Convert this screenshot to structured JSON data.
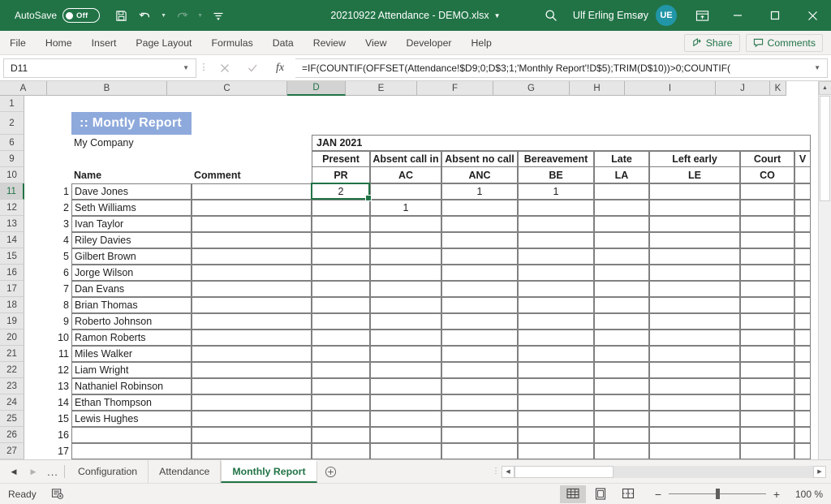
{
  "titlebar": {
    "autosave_label": "AutoSave",
    "autosave_state": "Off",
    "document_title": "20210922 Attendance - DEMO.xlsx",
    "user_name": "Ulf Erling Emsøy",
    "avatar_initials": "UE",
    "qat": [
      "save-icon",
      "undo-icon",
      "redo-icon",
      "customize-qat-icon"
    ],
    "window_buttons": [
      "minimize",
      "maximize",
      "close"
    ],
    "search_icon": "search-icon",
    "ribbon_display_icon": "ribbon-display-options-icon"
  },
  "ribbon": {
    "tabs": [
      "File",
      "Home",
      "Insert",
      "Page Layout",
      "Formulas",
      "Data",
      "Review",
      "View",
      "Developer",
      "Help"
    ],
    "share_label": "Share",
    "comments_label": "Comments"
  },
  "formulabar": {
    "namebox_value": "D11",
    "cancel_icon": "cancel-icon",
    "enter_icon": "confirm-icon",
    "function_icon": "insert-function-icon",
    "formula": "=IF(COUNTIF(OFFSET(Attendance!$D9;0;D$3;1;'Monthly Report'!D$5);TRIM(D$10))>0;COUNTIF("
  },
  "grid": {
    "columns": [
      "A",
      "B",
      "C",
      "D",
      "E",
      "F",
      "G",
      "H",
      "I",
      "J",
      "K"
    ],
    "selected_column": "D",
    "selected_row": "11",
    "row_headers": [
      "1",
      "2",
      "6",
      "9",
      "10",
      "11",
      "12",
      "13",
      "14",
      "15",
      "16",
      "17",
      "18",
      "19",
      "20",
      "21",
      "22",
      "23",
      "24",
      "25",
      "26",
      "27"
    ],
    "report_title": ":: Montly Report",
    "company": "My Company",
    "period": "JAN 2021",
    "header_name": "Name",
    "header_comment": "Comment",
    "category_headers": [
      "Present",
      "Absent call in",
      "Absent no call",
      "Bereavement",
      "Late",
      "Left early",
      "Court",
      "V"
    ],
    "category_codes": [
      "PR",
      "AC",
      "ANC",
      "BE",
      "LA",
      "LE",
      "CO",
      ""
    ],
    "rows": [
      {
        "num": "1",
        "name": "Dave Jones",
        "comment": "",
        "pr": "2",
        "ac": "",
        "anc": "1",
        "be": "1",
        "la": "",
        "le": "",
        "co": "",
        "v": ""
      },
      {
        "num": "2",
        "name": "Seth Williams",
        "comment": "",
        "pr": "",
        "ac": "1",
        "anc": "",
        "be": "",
        "la": "",
        "le": "",
        "co": "",
        "v": ""
      },
      {
        "num": "3",
        "name": "Ivan Taylor",
        "comment": "",
        "pr": "",
        "ac": "",
        "anc": "",
        "be": "",
        "la": "",
        "le": "",
        "co": "",
        "v": ""
      },
      {
        "num": "4",
        "name": "Riley Davies",
        "comment": "",
        "pr": "",
        "ac": "",
        "anc": "",
        "be": "",
        "la": "",
        "le": "",
        "co": "",
        "v": ""
      },
      {
        "num": "5",
        "name": "Gilbert Brown",
        "comment": "",
        "pr": "",
        "ac": "",
        "anc": "",
        "be": "",
        "la": "",
        "le": "",
        "co": "",
        "v": ""
      },
      {
        "num": "6",
        "name": "Jorge Wilson",
        "comment": "",
        "pr": "",
        "ac": "",
        "anc": "",
        "be": "",
        "la": "",
        "le": "",
        "co": "",
        "v": ""
      },
      {
        "num": "7",
        "name": "Dan Evans",
        "comment": "",
        "pr": "",
        "ac": "",
        "anc": "",
        "be": "",
        "la": "",
        "le": "",
        "co": "",
        "v": ""
      },
      {
        "num": "8",
        "name": "Brian Thomas",
        "comment": "",
        "pr": "",
        "ac": "",
        "anc": "",
        "be": "",
        "la": "",
        "le": "",
        "co": "",
        "v": ""
      },
      {
        "num": "9",
        "name": "Roberto Johnson",
        "comment": "",
        "pr": "",
        "ac": "",
        "anc": "",
        "be": "",
        "la": "",
        "le": "",
        "co": "",
        "v": ""
      },
      {
        "num": "10",
        "name": "Ramon Roberts",
        "comment": "",
        "pr": "",
        "ac": "",
        "anc": "",
        "be": "",
        "la": "",
        "le": "",
        "co": "",
        "v": ""
      },
      {
        "num": "11",
        "name": "Miles Walker",
        "comment": "",
        "pr": "",
        "ac": "",
        "anc": "",
        "be": "",
        "la": "",
        "le": "",
        "co": "",
        "v": ""
      },
      {
        "num": "12",
        "name": "Liam Wright",
        "comment": "",
        "pr": "",
        "ac": "",
        "anc": "",
        "be": "",
        "la": "",
        "le": "",
        "co": "",
        "v": ""
      },
      {
        "num": "13",
        "name": "Nathaniel Robinson",
        "comment": "",
        "pr": "",
        "ac": "",
        "anc": "",
        "be": "",
        "la": "",
        "le": "",
        "co": "",
        "v": ""
      },
      {
        "num": "14",
        "name": "Ethan Thompson",
        "comment": "",
        "pr": "",
        "ac": "",
        "anc": "",
        "be": "",
        "la": "",
        "le": "",
        "co": "",
        "v": ""
      },
      {
        "num": "15",
        "name": "Lewis Hughes",
        "comment": "",
        "pr": "",
        "ac": "",
        "anc": "",
        "be": "",
        "la": "",
        "le": "",
        "co": "",
        "v": ""
      },
      {
        "num": "16",
        "name": "",
        "comment": "",
        "pr": "",
        "ac": "",
        "anc": "",
        "be": "",
        "la": "",
        "le": "",
        "co": "",
        "v": ""
      },
      {
        "num": "17",
        "name": "",
        "comment": "",
        "pr": "",
        "ac": "",
        "anc": "",
        "be": "",
        "la": "",
        "le": "",
        "co": "",
        "v": ""
      }
    ]
  },
  "sheettabs": {
    "sheets": [
      "Configuration",
      "Attendance",
      "Monthly Report"
    ],
    "active": "Monthly Report",
    "add_sheet_icon": "add-sheet-icon",
    "overflow_label": "..."
  },
  "statusbar": {
    "mode": "Ready",
    "macro_icon": "record-macro-icon",
    "views": [
      "normal-view-icon",
      "page-layout-icon",
      "page-break-preview-icon"
    ],
    "active_view": "normal-view-icon",
    "zoom_out": "−",
    "zoom_in": "+",
    "zoom_value": "100 %"
  },
  "colors": {
    "excel_green": "#217346",
    "banner_blue": "#8ea9db",
    "avatar_teal": "#2196a8"
  }
}
